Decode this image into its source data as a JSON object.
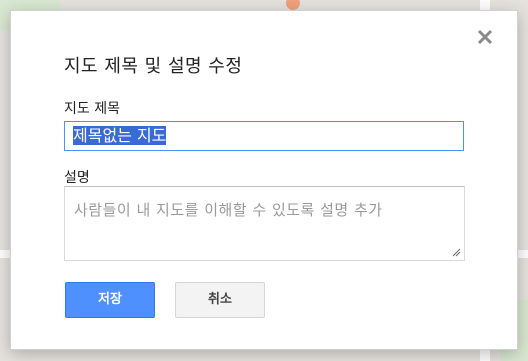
{
  "dialog": {
    "title": "지도 제목 및 설명 수정",
    "close_icon": "close-icon",
    "title_field": {
      "label": "지도 제목",
      "value": "제목없는 지도"
    },
    "description_field": {
      "label": "설명",
      "placeholder": "사람들이 내 지도를 이해할 수 있도록 설명 추가"
    },
    "buttons": {
      "save": "저장",
      "cancel": "취소"
    }
  },
  "colors": {
    "primary_button": "#4d90fe",
    "selection_highlight": "#3a6ad6",
    "map_background": "#e6e3df"
  }
}
